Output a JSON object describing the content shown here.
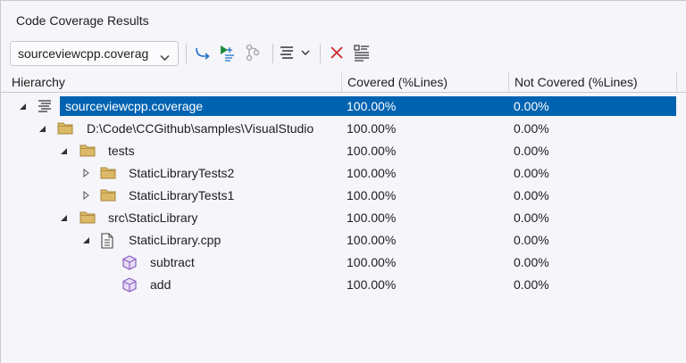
{
  "window": {
    "title": "Code Coverage Results"
  },
  "toolbar": {
    "file_select": "sourceviewcpp.coverag",
    "buttons": [
      {
        "icon": "import-results-icon"
      },
      {
        "icon": "run-tests-icon"
      },
      {
        "icon": "merge-results-icon"
      },
      {
        "icon": "sort-options-icon"
      },
      {
        "icon": "delete-results-icon"
      },
      {
        "icon": "coverage-coloring-icon"
      }
    ]
  },
  "grid": {
    "columns": [
      "Hierarchy",
      "Covered (%Lines)",
      "Not Covered (%Lines)"
    ],
    "rows": [
      {
        "name": "sourceviewcpp.coverage",
        "covered": "100.00%",
        "not_covered": "0.00%",
        "icon": "coverage-file-icon",
        "expand": "expanded",
        "selected": true
      },
      {
        "name": "D:\\Code\\CCGithub\\samples\\VisualStudio",
        "covered": "100.00%",
        "not_covered": "0.00%",
        "icon": "folder-icon",
        "expand": "expanded",
        "selected": false
      },
      {
        "name": "tests",
        "covered": "100.00%",
        "not_covered": "0.00%",
        "icon": "folder-icon",
        "expand": "expanded",
        "selected": false
      },
      {
        "name": "StaticLibraryTests2",
        "covered": "100.00%",
        "not_covered": "0.00%",
        "icon": "folder-icon",
        "expand": "collapsed",
        "selected": false
      },
      {
        "name": "StaticLibraryTests1",
        "covered": "100.00%",
        "not_covered": "0.00%",
        "icon": "folder-icon",
        "expand": "collapsed",
        "selected": false
      },
      {
        "name": "src\\StaticLibrary",
        "covered": "100.00%",
        "not_covered": "0.00%",
        "icon": "folder-icon",
        "expand": "expanded",
        "selected": false
      },
      {
        "name": "StaticLibrary.cpp",
        "covered": "100.00%",
        "not_covered": "0.00%",
        "icon": "document-icon",
        "expand": "expanded",
        "selected": false
      },
      {
        "name": "subtract",
        "covered": "100.00%",
        "not_covered": "0.00%",
        "icon": "method-icon",
        "expand": "none",
        "selected": false
      },
      {
        "name": "add",
        "covered": "100.00%",
        "not_covered": "0.00%",
        "icon": "method-icon",
        "expand": "none",
        "selected": false
      }
    ]
  },
  "colors": {
    "selection": "#0063b1",
    "folder": "#c5a14e",
    "method": "#8a5cc2"
  }
}
